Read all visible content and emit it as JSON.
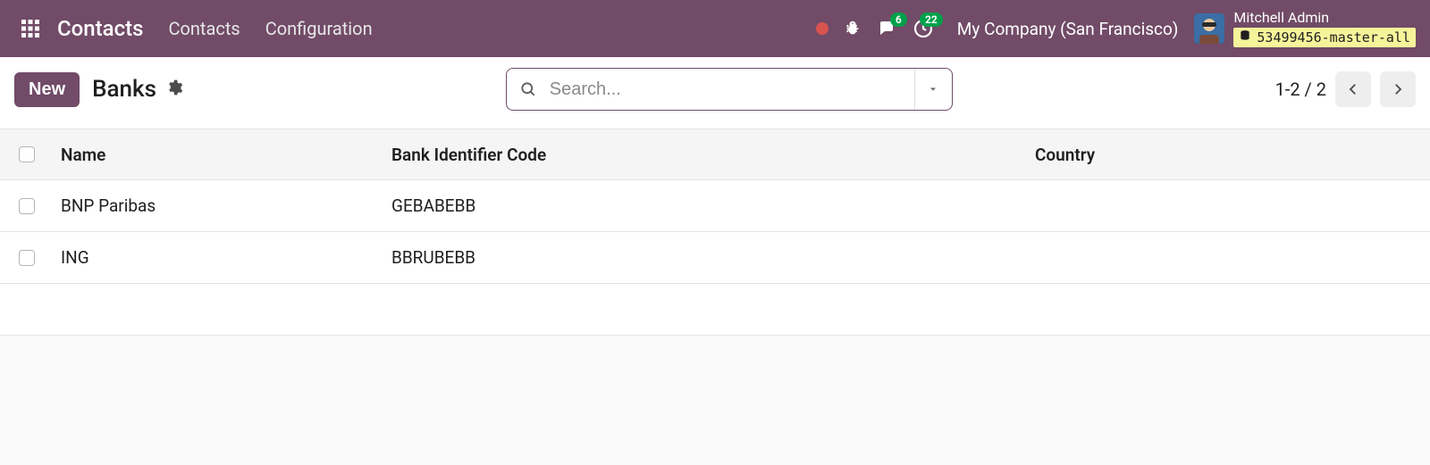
{
  "topnav": {
    "brand": "Contacts",
    "links": [
      "Contacts",
      "Configuration"
    ],
    "messaging_badge": "6",
    "activities_badge": "22",
    "company": "My Company (San Francisco)",
    "user_name": "Mitchell Admin",
    "db_name": "53499456-master-all"
  },
  "controlpanel": {
    "new_label": "New",
    "breadcrumb": "Banks",
    "search_placeholder": "Search...",
    "pager": "1-2 / 2"
  },
  "table": {
    "columns": {
      "name": "Name",
      "bic": "Bank Identifier Code",
      "country": "Country"
    },
    "rows": [
      {
        "name": "BNP Paribas",
        "bic": "GEBABEBB",
        "country": ""
      },
      {
        "name": "ING",
        "bic": "BBRUBEBB",
        "country": ""
      }
    ]
  }
}
